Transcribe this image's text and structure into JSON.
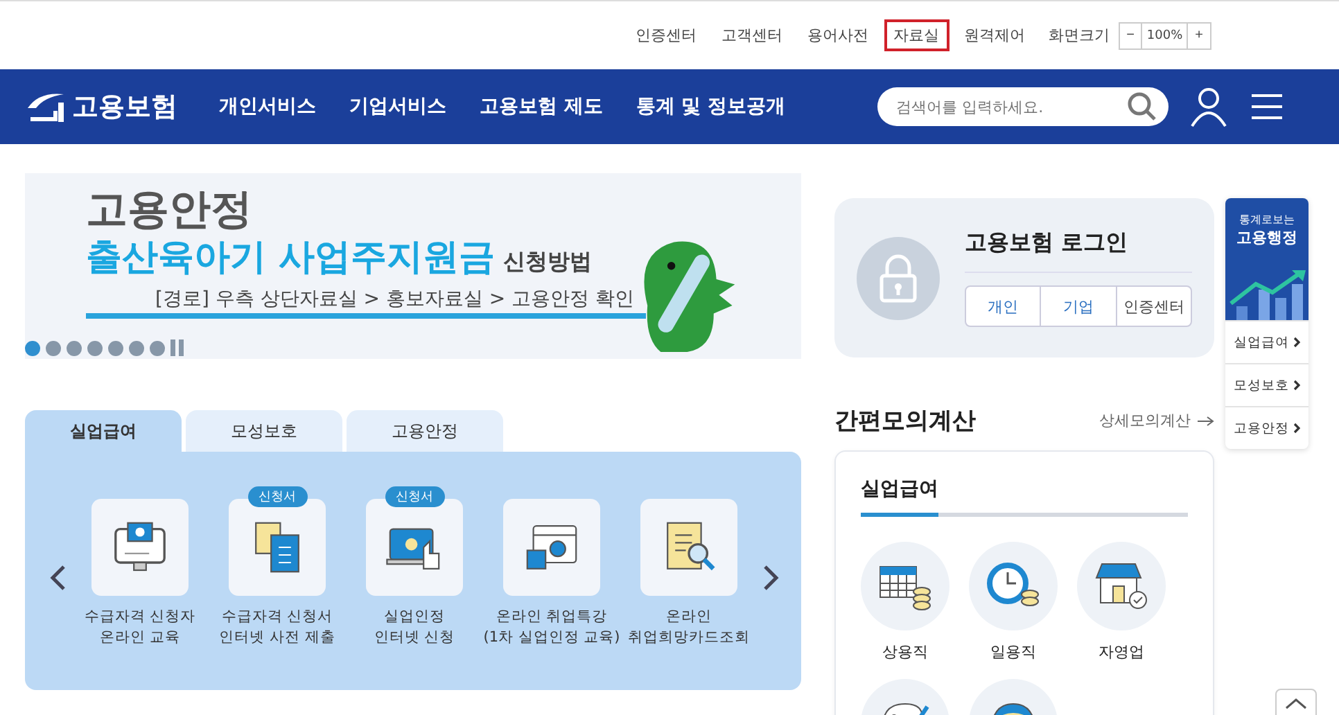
{
  "utility_links": [
    {
      "label": "인증센터",
      "highlighted": false
    },
    {
      "label": "고객센터",
      "highlighted": false
    },
    {
      "label": "용어사전",
      "highlighted": false
    },
    {
      "label": "자료실",
      "highlighted": true
    },
    {
      "label": "원격제어",
      "highlighted": false
    }
  ],
  "zoom": {
    "label": "화면크기",
    "minus": "−",
    "value": "100%",
    "plus": "+"
  },
  "header": {
    "logo": "고용보험",
    "nav": [
      "개인서비스",
      "기업서비스",
      "고용보험 제도",
      "통계 및 정보공개"
    ],
    "search": {
      "placeholder": "검색어를 입력하세요."
    }
  },
  "banner": {
    "title": "고용안정",
    "headline": "출산육아기 사업주지원금",
    "headline_suffix": "신청방법",
    "path": "[경로] 우측 상단자료실 > 홍보자료실 > 고용안정 확인",
    "slides": [
      {
        "selected": true
      },
      {
        "selected": false
      },
      {
        "selected": false
      },
      {
        "selected": false
      },
      {
        "selected": false
      },
      {
        "selected": false
      },
      {
        "selected": false
      }
    ]
  },
  "service_tabs": [
    {
      "label": "실업급여",
      "selected": true
    },
    {
      "label": "모성보호",
      "selected": false
    },
    {
      "label": "고용안정",
      "selected": false
    }
  ],
  "services": [
    {
      "kind": "monitor",
      "lines": [
        "수급자격 신청자",
        "온라인 교육"
      ]
    },
    {
      "kind": "documents",
      "badge": "신청서",
      "lines": [
        "수급자격 신청서",
        "인터넷 사전 제출"
      ]
    },
    {
      "kind": "laptop",
      "badge": "신청서",
      "lines": [
        "실업인정",
        "인터넷 신청"
      ]
    },
    {
      "kind": "video",
      "lines": [
        "온라인 취업특강",
        "(1차 실업인정 교육)"
      ]
    },
    {
      "kind": "card",
      "lines": [
        "온라인",
        "취업희망카드조회"
      ]
    }
  ],
  "login": {
    "title": "고용보험 로그인",
    "buttons": [
      "개인",
      "기업",
      "인증센터"
    ]
  },
  "side_panel": {
    "subtitle": "통계로보는",
    "title": "고용행정",
    "links": [
      "실업급여",
      "모성보호",
      "고용안정"
    ]
  },
  "calculator": {
    "title": "간편모의계산",
    "detail_link": "상세모의계산",
    "tab": "실업급여",
    "items": [
      {
        "kind": "calendar",
        "label": "상용직"
      },
      {
        "kind": "clock",
        "label": "일용직"
      },
      {
        "kind": "store",
        "label": "자영업"
      },
      {
        "kind": "palette"
      },
      {
        "kind": "helmet"
      }
    ]
  }
}
